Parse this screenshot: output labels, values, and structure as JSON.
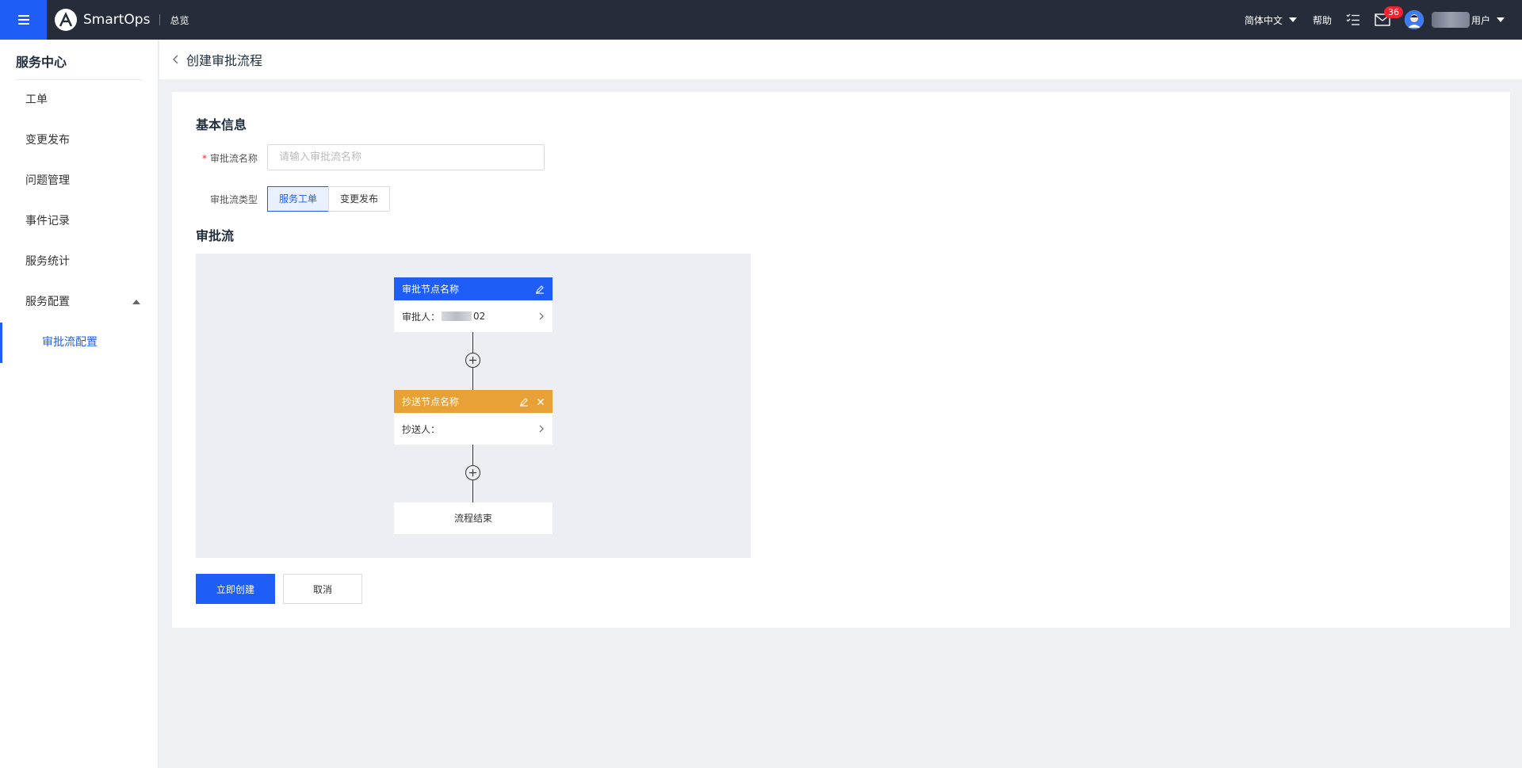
{
  "topbar": {
    "app_name": "SmartOps",
    "nav_overview": "总览",
    "language": "简体中文",
    "help": "帮助",
    "mail_badge": "36",
    "user_suffix": "用户"
  },
  "sidebar": {
    "title": "服务中心",
    "items": [
      {
        "label": "工单"
      },
      {
        "label": "变更发布"
      },
      {
        "label": "问题管理"
      },
      {
        "label": "事件记录"
      },
      {
        "label": "服务统计"
      },
      {
        "label": "服务配置"
      }
    ],
    "sub_items": [
      {
        "label": "审批流配置",
        "active": true
      }
    ]
  },
  "header": {
    "title": "创建审批流程"
  },
  "form": {
    "basic_info_title": "基本信息",
    "required_mark": "*",
    "name_label": "审批流名称",
    "name_placeholder": "请输入审批流名称",
    "name_value": "",
    "type_label": "审批流类型",
    "type_options": [
      "服务工单",
      "变更发布"
    ],
    "type_selected": "服务工单",
    "flow_title": "审批流"
  },
  "flow": {
    "approval_node": {
      "name": "审批节点名称",
      "field_label": "审批人：",
      "value_suffix": "02"
    },
    "cc_node": {
      "name": "抄送节点名称",
      "field_label": "抄送人："
    },
    "end_node": "流程结束"
  },
  "actions": {
    "create": "立即创建",
    "cancel": "取消"
  },
  "colors": {
    "primary": "#1f5ef6",
    "topbar": "#272c3b",
    "cc_node": "#e8a136",
    "badge": "#f5222d"
  }
}
